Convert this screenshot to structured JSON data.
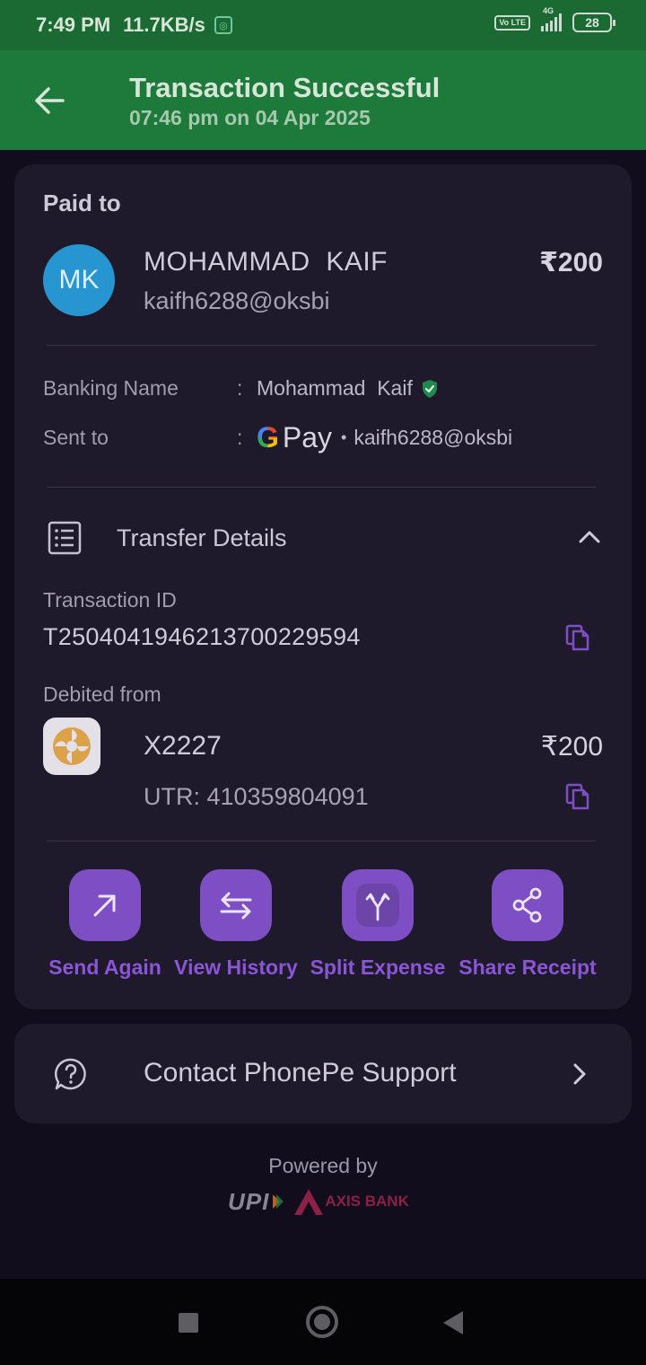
{
  "status_bar": {
    "time": "7:49 PM",
    "speed": "11.7KB/s",
    "volte": "Vo LTE",
    "network": "4G",
    "battery": "28"
  },
  "app_bar": {
    "title": "Transaction Successful",
    "subtitle": "07:46 pm on 04 Apr 2025",
    "color": "#1d7a3a"
  },
  "payment": {
    "paid_to_label": "Paid to",
    "avatar_initials": "MK",
    "payee_name": "MOHAMMAD  KAIF",
    "payee_upi": "kaifh6288@oksbi",
    "amount": "₹200",
    "banking_name_label": "Banking Name",
    "banking_name": "Mohammad  Kaif",
    "sent_to_label": "Sent to",
    "sent_to_app": "Pay",
    "sent_to_app_g": "G",
    "sent_to_upi": "kaifh6288@oksbi",
    "separator": ":",
    "dot": "•"
  },
  "transfer_details": {
    "title": "Transfer Details",
    "transaction_id_label": "Transaction ID",
    "transaction_id": "T2504041946213700229594",
    "debited_from_label": "Debited from",
    "account": "X2227",
    "debit_amount": "₹200",
    "utr": "UTR: 410359804091"
  },
  "actions": [
    {
      "label": "Send Again",
      "icon": "arrow-up-right-icon"
    },
    {
      "label": "View History",
      "icon": "swap-arrows-icon"
    },
    {
      "label": "Split Expense",
      "icon": "split-icon"
    },
    {
      "label": "Share Receipt",
      "icon": "share-icon"
    }
  ],
  "support": {
    "label": "Contact PhonePe Support"
  },
  "footer": {
    "powered_by": "Powered by",
    "upi_logo": "UPI",
    "bank_logo": "AXIS BANK"
  },
  "colors": {
    "accent": "#7e4fc4",
    "accent_text": "#8a55d6",
    "success_header": "#1d7a3a",
    "card_bg": "#1f1a2b",
    "page_bg": "#110d1c"
  }
}
